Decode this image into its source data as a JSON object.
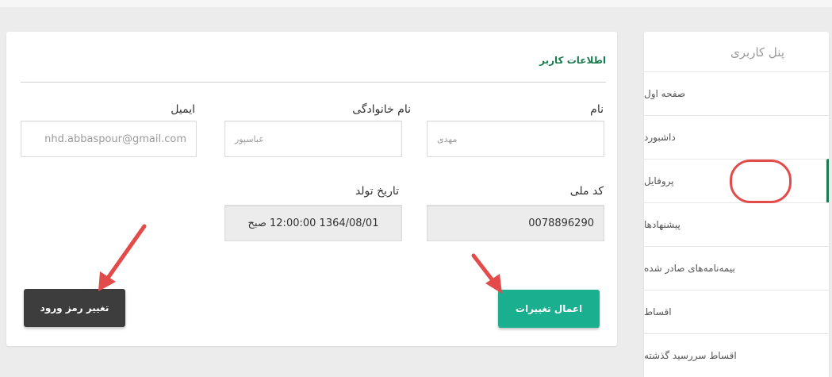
{
  "card": {
    "title": "اطلاعات کاربر",
    "fields": {
      "first_name": {
        "label": "نام",
        "value": "مهدی"
      },
      "last_name": {
        "label": "نام خانوادگی",
        "value": "عباسپور"
      },
      "email": {
        "label": "ایمیل",
        "value": "nhd.abbaspour@gmail.com"
      },
      "national_code": {
        "label": "کد ملی",
        "value": "0078896290"
      },
      "birth_date": {
        "label": "تاریخ تولد",
        "value": "1364/08/01 12:00:00 صبح"
      }
    },
    "apply_button": "اعمال تغییرات",
    "password_button": "تغییر رمز ورود"
  },
  "sidebar": {
    "title": "پنل کاربری",
    "items": [
      {
        "label": "صفحه اول"
      },
      {
        "label": "داشبورد"
      },
      {
        "label": "پروفایل"
      },
      {
        "label": "پیشنهادها"
      },
      {
        "label": "بیمه‌نامه‌های صادر شده"
      },
      {
        "label": "اقساط"
      },
      {
        "label": "اقساط سررسید گذشته"
      }
    ],
    "active_index": 2
  },
  "colors": {
    "accent_green": "#1b7a4f",
    "apply_button": "#1aaf8f",
    "password_button": "#3d3d3d",
    "annotation_red": "#e34b4b"
  }
}
